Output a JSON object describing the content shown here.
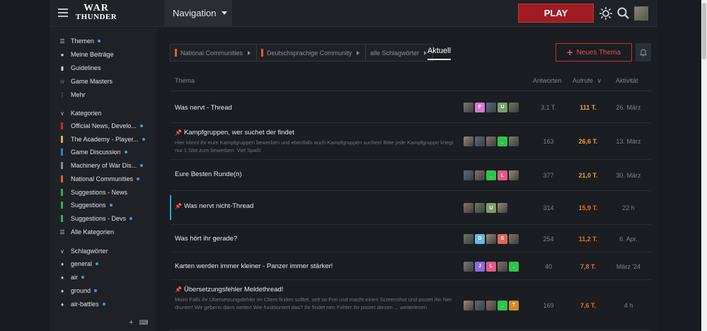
{
  "header": {
    "logo_line1": "WAR",
    "logo_line2": "THUNDER",
    "navigation_label": "Navigation",
    "play_label": "PLAY"
  },
  "sidebar": {
    "top_items": [
      {
        "label": "Themen",
        "icon": "stack-icon",
        "dot": true
      },
      {
        "label": "Meine Beiträge",
        "icon": "user-icon",
        "dot": false
      },
      {
        "label": "Guidelines",
        "icon": "book-icon",
        "dot": false
      },
      {
        "label": "Game Masters",
        "icon": "star-icon",
        "dot": false
      },
      {
        "label": "Mehr",
        "icon": "more-icon",
        "dot": false
      }
    ],
    "categories_heading": "Kategorien",
    "categories": [
      {
        "label": "Official News, Develo...",
        "color": "#d8262f",
        "dot": true
      },
      {
        "label": "The Academy - Player...",
        "color": "#f3a84a",
        "dot": true
      },
      {
        "label": "Game Discussion",
        "color": "#2d7cd6",
        "dot": true
      },
      {
        "label": "Machinery of War Dis...",
        "color": "#8c8c8c",
        "dot": true
      },
      {
        "label": "National Communities",
        "color": "#e85a2a",
        "dot": true
      },
      {
        "label": "Suggestions - News",
        "color": "#2fb34a",
        "dot": false
      },
      {
        "label": "Suggestions",
        "color": "#2fb34a",
        "dot": true
      },
      {
        "label": "Suggestions - Devs",
        "color": "#2fb34a",
        "dot": true
      }
    ],
    "all_categories_label": "Alle Kategorien",
    "tags_heading": "Schlagwörter",
    "tags": [
      {
        "label": "general",
        "dot": true
      },
      {
        "label": "air",
        "dot": true
      },
      {
        "label": "ground",
        "dot": true
      },
      {
        "label": "air-battles",
        "dot": true
      }
    ]
  },
  "breadcrumbs": [
    {
      "label": "National Communities",
      "color": "#e85a2a"
    },
    {
      "label": "Deutschsprachige Community",
      "color": "#e85a2a"
    },
    {
      "label": "alle Schlagwörter",
      "color": ""
    }
  ],
  "current_tab": "Aktuell",
  "new_topic_label": "Neues Thema",
  "columns": {
    "topic": "Thema",
    "replies": "Antworten",
    "views": "Aufrufe",
    "activity": "Aktivität"
  },
  "topics": [
    {
      "title": "Was nervt - Thread",
      "pinned": false,
      "excerpt": "",
      "posters": [
        "img",
        "F",
        "img",
        "U",
        "img"
      ],
      "replies": "3,1 T.",
      "views": "111 T.",
      "views_color": "#e8a23a",
      "activity": "26. März"
    },
    {
      "title": "Kampfgruppen, wer suchet der findet",
      "pinned": true,
      "excerpt": "Hier könnt ihr eure Kampfgruppen bewerben und ebenfalls auch Kampfgruppen suchen! Bitte jede Kampfgruppe kriegt nur 1 Slot zum bewerben. Viel Spaß!",
      "posters": [
        "img",
        "img",
        "img",
        "_",
        "img"
      ],
      "replies": "163",
      "views": "26,6 T.",
      "views_color": "#e8a23a",
      "activity": "13. März"
    },
    {
      "title": "Eure Besten Runde(n)",
      "pinned": false,
      "excerpt": "",
      "posters": [
        "img",
        "img",
        "_",
        "L",
        "img"
      ],
      "replies": "377",
      "views": "21,0 T.",
      "views_color": "#e8a23a",
      "activity": "30. März"
    },
    {
      "title": "Was nervt nicht-Thread",
      "pinned": true,
      "excerpt": "",
      "posters": [
        "img",
        "img",
        "U",
        "img"
      ],
      "replies": "314",
      "views": "15,9 T.",
      "views_color": "#e8731f",
      "activity": "22 h"
    },
    {
      "title": "Was hört ihr gerade?",
      "pinned": false,
      "excerpt": "",
      "posters": [
        "img",
        "D",
        "img",
        "S",
        "img"
      ],
      "replies": "254",
      "views": "11,2 T.",
      "views_color": "#e8731f",
      "activity": "6. Apr."
    },
    {
      "title": "Karten werden immer kleiner - Panzer immer stärker!",
      "pinned": false,
      "excerpt": "",
      "posters": [
        "img",
        "J",
        "L",
        "img",
        "_"
      ],
      "replies": "40",
      "views": "7,8 T.",
      "views_color": "#e8731f",
      "activity": "März '24"
    },
    {
      "title": "Übersetzungsfehler Meldethread!",
      "pinned": true,
      "excerpt": "Moin! Falls ihr Übersetzungsfehler im Client finden solltet, seit so Frei und macht einen Screenshot und postet ihn hier drunter! Wir gebens dann weiter! Wie funktioniert das? Ihr findet nen Fehler Ihr postet diesen ... weiterlesen",
      "posters": [
        "img",
        "img",
        "img",
        "_",
        "T"
      ],
      "replies": "169",
      "views": "7,6 T.",
      "views_color": "#e8731f",
      "activity": "4 h"
    }
  ]
}
